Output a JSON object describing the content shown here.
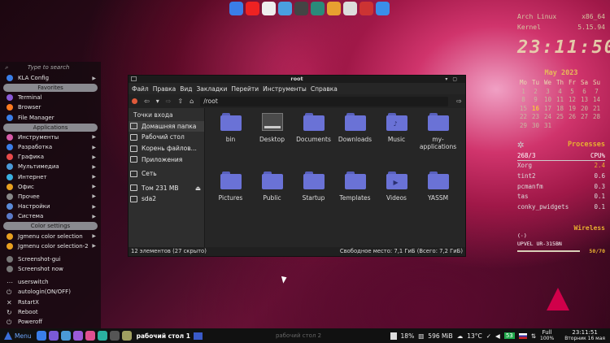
{
  "top_dock": [
    {
      "name": "files",
      "color": "#3a7ee8"
    },
    {
      "name": "yandex-browser",
      "color": "#e22"
    },
    {
      "name": "pirate",
      "color": "#eee"
    },
    {
      "name": "apps",
      "color": "#4aa0e0"
    },
    {
      "name": "keyboard",
      "color": "#444"
    },
    {
      "name": "camera",
      "color": "#2a8a7a"
    },
    {
      "name": "photos",
      "color": "#e8a030"
    },
    {
      "name": "disk",
      "color": "#ddd"
    },
    {
      "name": "cd",
      "color": "#c33"
    },
    {
      "name": "app-store",
      "color": "#3a8ee8"
    }
  ],
  "sidebar": {
    "search_placeholder": "Type to search",
    "top_items": [
      {
        "label": "KLA Config",
        "color": "#3a7ee8"
      }
    ],
    "sections": [
      {
        "title": "Favorites",
        "items": [
          {
            "label": "Terminal",
            "color": "#8a5ad8"
          },
          {
            "label": "Browser",
            "color": "#ff7a20"
          },
          {
            "label": "File Manager",
            "color": "#3a7ee8"
          }
        ]
      },
      {
        "title": "Applications",
        "items": [
          {
            "label": "Инструменты",
            "color": "#d85aa8"
          },
          {
            "label": "Разработка",
            "color": "#3a7ee8"
          },
          {
            "label": "Графика",
            "color": "#e84a4a"
          },
          {
            "label": "Мультимедиа",
            "color": "#4a9ad8"
          },
          {
            "label": "Интернет",
            "color": "#3ab0e0"
          },
          {
            "label": "Офис",
            "color": "#e8a020"
          },
          {
            "label": "Прочее",
            "color": "#888"
          },
          {
            "label": "Настройки",
            "color": "#5a8ad8"
          },
          {
            "label": "Система",
            "color": "#5a7ac8"
          }
        ]
      },
      {
        "title": "Color settings",
        "items": [
          {
            "label": "Jgmenu color selection",
            "color": "#e8a020"
          },
          {
            "label": "Jgmenu color selection-2",
            "color": "#e8a020"
          }
        ]
      }
    ],
    "screenshot_items": [
      {
        "label": "Screenshot-gui",
        "color": "#777"
      },
      {
        "label": "Screenshot now",
        "color": "#777"
      }
    ],
    "session_items": [
      {
        "label": "userswitch",
        "glyph": "⋯"
      },
      {
        "label": "autologin(ON/OFF)",
        "glyph": "⏻"
      },
      {
        "label": "RstartX",
        "glyph": "✕"
      },
      {
        "label": "Reboot",
        "glyph": "↻"
      },
      {
        "label": "Poweroff",
        "glyph": "⏻"
      }
    ]
  },
  "file_manager": {
    "title": "root",
    "menu": [
      "Файл",
      "Правка",
      "Вид",
      "Закладки",
      "Перейти",
      "Инструменты",
      "Справка"
    ],
    "path": "/root",
    "places_header": "Точки входа",
    "places": [
      {
        "label": "Домашняя папка",
        "selected": true
      },
      {
        "label": "Рабочий стол",
        "selected": false
      },
      {
        "label": "Корень файлов...",
        "selected": false
      },
      {
        "label": "Приложения",
        "selected": false
      },
      {
        "label": "Сеть",
        "selected": false
      },
      {
        "label": "Том 231 MB",
        "selected": false,
        "eject": true
      },
      {
        "label": "sda2",
        "selected": false
      }
    ],
    "items": [
      {
        "label": "bin",
        "type": "folder",
        "emblem": ""
      },
      {
        "label": "Desktop",
        "type": "desktop",
        "emblem": ""
      },
      {
        "label": "Documents",
        "type": "folder",
        "emblem": ""
      },
      {
        "label": "Downloads",
        "type": "folder",
        "emblem": ""
      },
      {
        "label": "Music",
        "type": "folder",
        "emblem": "♪"
      },
      {
        "label": "my-applications",
        "type": "folder",
        "emblem": ""
      },
      {
        "label": "Pictures",
        "type": "folder",
        "emblem": ""
      },
      {
        "label": "Public",
        "type": "folder",
        "emblem": ""
      },
      {
        "label": "Startup",
        "type": "folder",
        "emblem": ""
      },
      {
        "label": "Templates",
        "type": "folder",
        "emblem": ""
      },
      {
        "label": "Videos",
        "type": "folder",
        "emblem": "▶"
      },
      {
        "label": "YASSM",
        "type": "folder",
        "emblem": ""
      }
    ],
    "status_left": "12 элементов (27 скрыто)",
    "status_right": "Свободное место: 7,1 ГиБ (Всего: 7,2 ГиБ)"
  },
  "conky": {
    "os_label": "Arch Linux",
    "arch": "x86_64",
    "kernel_label": "Kernel",
    "kernel": "5.15.94",
    "time": "23:11:50",
    "month": "May 2023",
    "weekdays": [
      "Mo",
      "Tu",
      "We",
      "Th",
      "Fr",
      "Sa",
      "Su"
    ],
    "days": [
      "1",
      "2",
      "3",
      "4",
      "5",
      "6",
      "7",
      "8",
      "9",
      "10",
      "11",
      "12",
      "13",
      "14",
      "15",
      "16",
      "17",
      "18",
      "19",
      "20",
      "21",
      "22",
      "23",
      "24",
      "25",
      "26",
      "27",
      "28",
      "29",
      "30",
      "31"
    ],
    "today": "16",
    "processes_title": "Processes",
    "proc_count": "268/3",
    "cpu_label": "CPU%",
    "processes": [
      {
        "name": "Xorg",
        "cpu": "2.4"
      },
      {
        "name": "tint2",
        "cpu": "0.6"
      },
      {
        "name": "pcmanfm",
        "cpu": "0.3"
      },
      {
        "name": "tas",
        "cpu": "0.1"
      },
      {
        "name": "conky_pwidgets",
        "cpu": "0.1"
      }
    ],
    "wireless_title": "Wireless",
    "wireless_icon": "(·)",
    "wireless_device": "UPVEL UR-315BN",
    "wireless_signal": "50/70",
    "wireless_level": 0.71
  },
  "taskbar": {
    "menu_label": "Menu",
    "apps": [
      {
        "name": "files",
        "color": "#3a7ee8"
      },
      {
        "name": "browser",
        "color": "#7a5ad8"
      },
      {
        "name": "app",
        "color": "#4a9ad8"
      },
      {
        "name": "media",
        "color": "#9a5ad8"
      },
      {
        "name": "player",
        "color": "#e05090"
      },
      {
        "name": "system",
        "color": "#2ab0a0"
      },
      {
        "name": "settings",
        "color": "#555"
      },
      {
        "name": "manager",
        "color": "#a0a060"
      }
    ],
    "workspace_1": "рабочий стол 1",
    "workspace_2": "рабочий стол 2",
    "battery": "18%",
    "memory": "596 MiB",
    "temperature": "13°C",
    "updates": "53",
    "volume": "Full",
    "volume_pct": "100%",
    "clock_time": "23:11:51",
    "clock_date": "Вторник 16 мая"
  }
}
